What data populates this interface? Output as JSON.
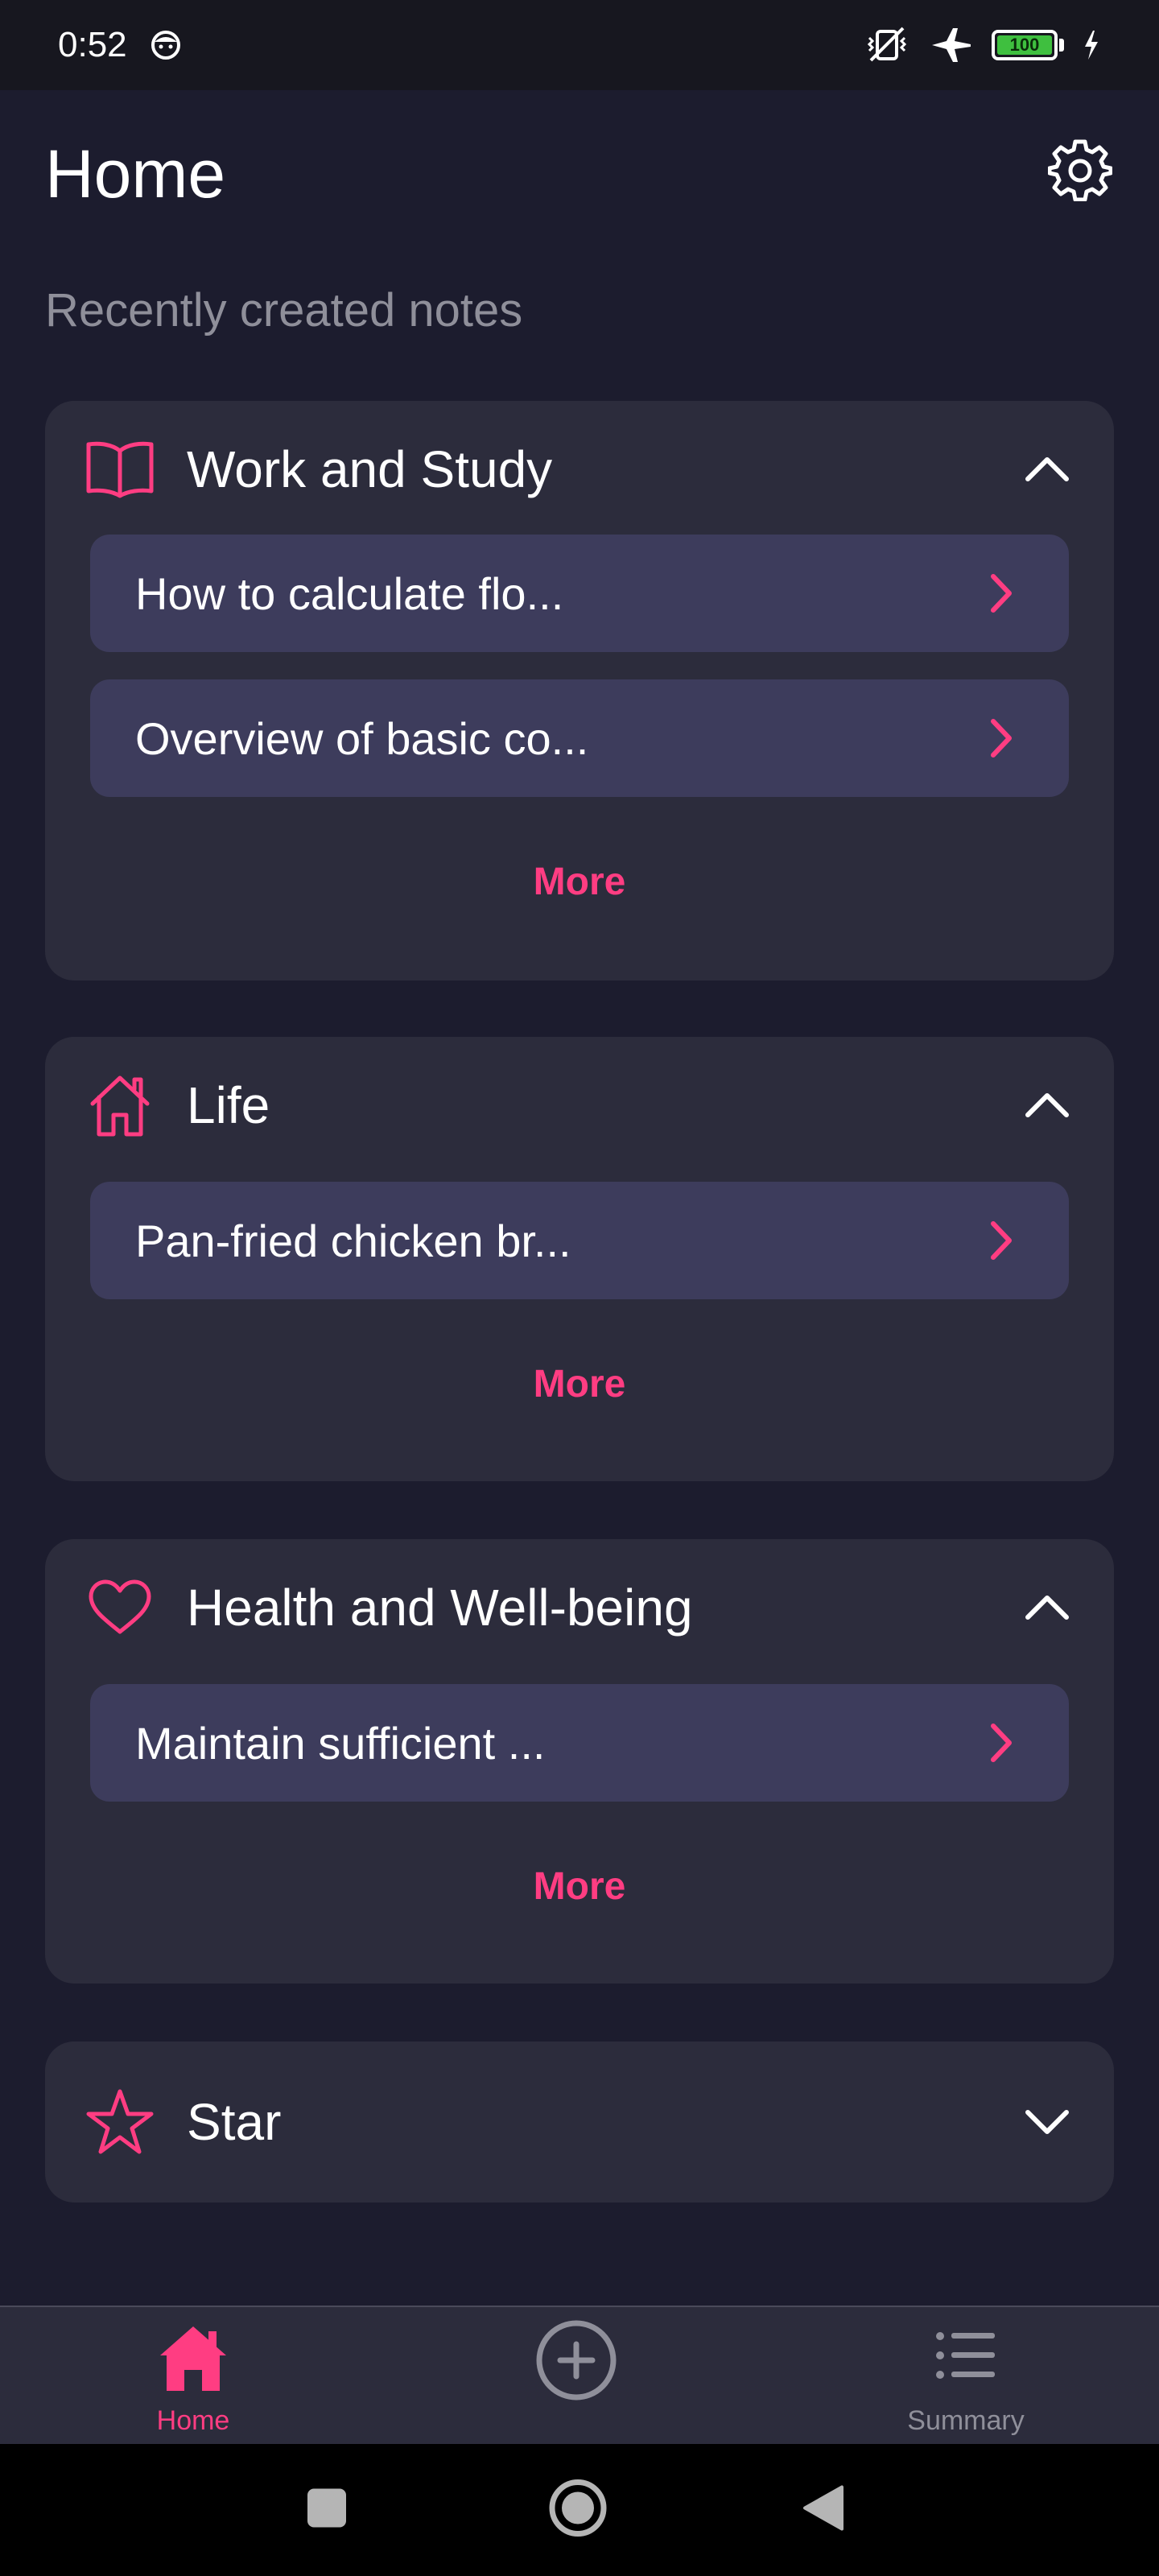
{
  "status_bar": {
    "time": "0:52",
    "battery_level": "100"
  },
  "header": {
    "title": "Home",
    "subtitle": "Recently created notes"
  },
  "categories": [
    {
      "title": "Work and Study",
      "icon": "book-icon",
      "expanded": true,
      "notes": [
        "How to calculate flo...",
        "Overview of basic co..."
      ],
      "more_label": "More"
    },
    {
      "title": "Life",
      "icon": "home-icon",
      "expanded": true,
      "notes": [
        "Pan-fried chicken br..."
      ],
      "more_label": "More"
    },
    {
      "title": "Health and Well-being",
      "icon": "heart-icon",
      "expanded": true,
      "notes": [
        "Maintain sufficient ..."
      ],
      "more_label": "More"
    },
    {
      "title": "Star",
      "icon": "star-icon",
      "expanded": false,
      "notes": [],
      "more_label": ""
    }
  ],
  "bottom_nav": {
    "items": [
      {
        "label": "Home",
        "icon": "home-filled-icon",
        "active": true
      },
      {
        "label": "",
        "icon": "add-circle-icon",
        "active": false
      },
      {
        "label": "Summary",
        "icon": "list-icon",
        "active": false
      }
    ]
  },
  "colors": {
    "background": "#1c1c2e",
    "card": "#2c2c3c",
    "note_item": "#3d3c5c",
    "accent": "#ff3d82",
    "subtitle": "#8f8f9a"
  }
}
